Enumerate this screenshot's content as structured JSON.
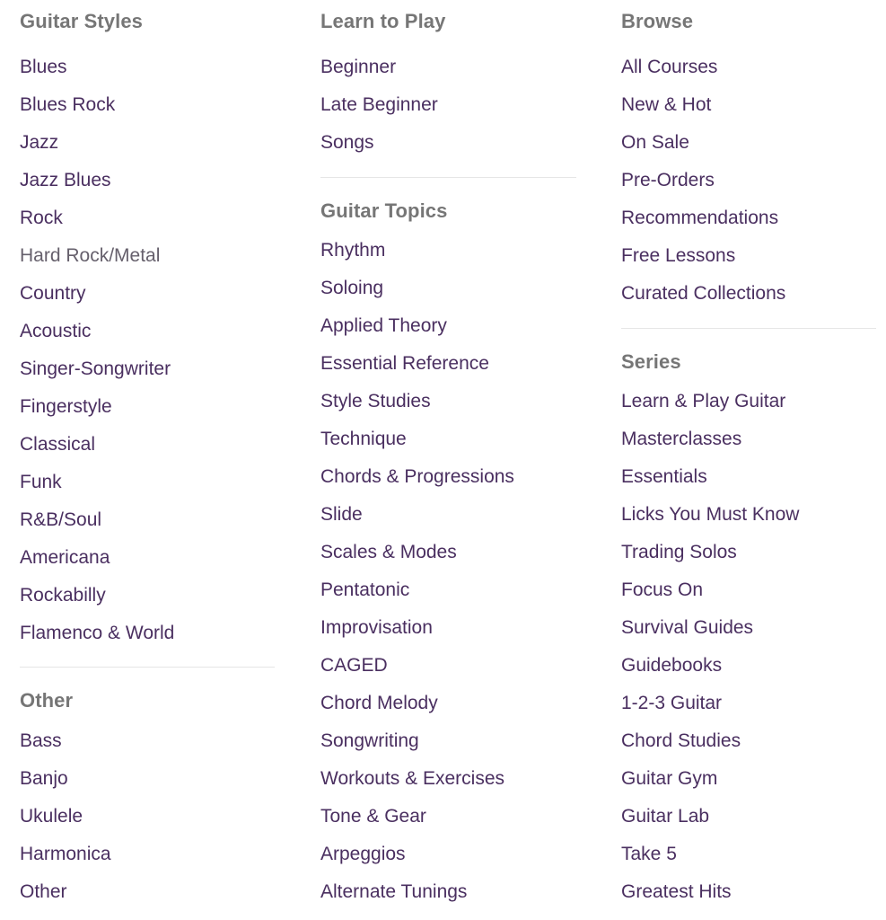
{
  "colors": {
    "link": "#4a2f60",
    "heading": "#767676",
    "hover": "#66606c",
    "divider": "#e6e6e6"
  },
  "columns": [
    {
      "sections": [
        {
          "title": "Guitar Styles",
          "items": [
            "Blues",
            "Blues Rock",
            "Jazz",
            "Jazz Blues",
            "Rock",
            "Hard Rock/Metal",
            "Country",
            "Acoustic",
            "Singer-Songwriter",
            "Fingerstyle",
            "Classical",
            "Funk",
            "R&B/Soul",
            "Americana",
            "Rockabilly",
            "Flamenco & World"
          ],
          "hovered_item": "Hard Rock/Metal"
        },
        {
          "title": "Other",
          "items": [
            "Bass",
            "Banjo",
            "Ukulele",
            "Harmonica",
            "Other"
          ]
        }
      ]
    },
    {
      "sections": [
        {
          "title": "Learn to Play",
          "items": [
            "Beginner",
            "Late Beginner",
            "Songs"
          ]
        },
        {
          "title": "Guitar Topics",
          "items": [
            "Rhythm",
            "Soloing",
            "Applied Theory",
            "Essential Reference",
            "Style Studies",
            "Technique",
            "Chords & Progressions",
            "Slide",
            "Scales & Modes",
            "Pentatonic",
            "Improvisation",
            "CAGED",
            "Chord Melody",
            "Songwriting",
            "Workouts & Exercises",
            "Tone & Gear",
            "Arpeggios",
            "Alternate Tunings"
          ]
        }
      ]
    },
    {
      "sections": [
        {
          "title": "Browse",
          "items": [
            "All Courses",
            "New & Hot",
            "On Sale",
            "Pre-Orders",
            "Recommendations",
            "Free Lessons",
            "Curated Collections"
          ]
        },
        {
          "title": "Series",
          "items": [
            "Learn & Play Guitar",
            "Masterclasses",
            "Essentials",
            "Licks You Must Know",
            "Trading Solos",
            "Focus On",
            "Survival Guides",
            "Guidebooks",
            "1-2-3 Guitar",
            "Chord Studies",
            "Guitar Gym",
            "Guitar Lab",
            "Take 5",
            "Greatest Hits"
          ]
        }
      ]
    }
  ]
}
